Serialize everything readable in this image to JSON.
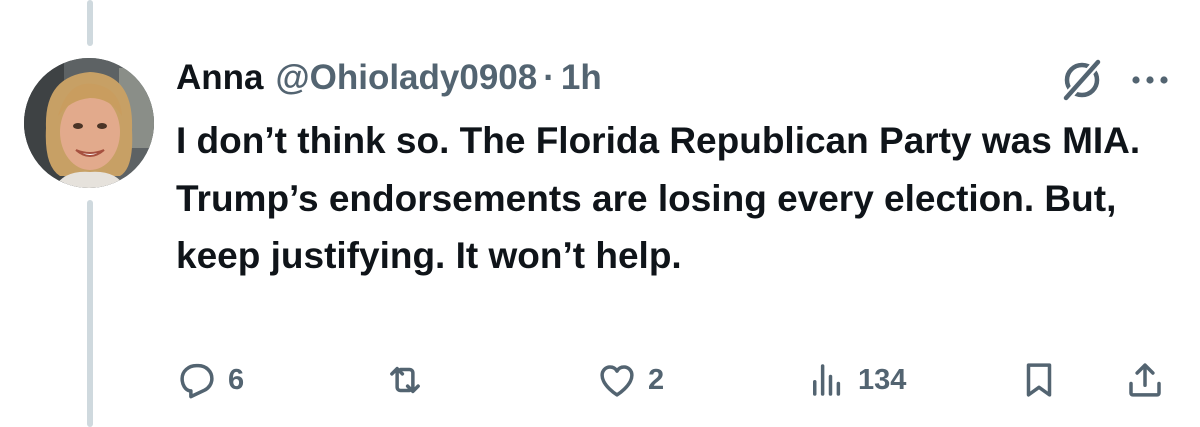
{
  "tweet": {
    "author_name": "Anna",
    "handle": "@Ohiolady0908",
    "separator": "·",
    "time": "1h",
    "text": "I don’t think so. The Florida Republican Party was MIA. Trump’s endorsements are losing every election. But, keep justifying. It won’t help."
  },
  "actions": {
    "replies": "6",
    "reposts": "",
    "likes": "2",
    "views": "134"
  },
  "icons": {
    "reply": "reply-icon",
    "repost": "repost-icon",
    "like": "heart-icon",
    "views": "views-icon",
    "bookmark": "bookmark-icon",
    "share": "share-icon",
    "grok": "grok-icon",
    "more": "more-icon"
  },
  "colors": {
    "text": "#0f1419",
    "secondary": "#536471",
    "thread_line": "#cfd9de",
    "background": "#ffffff"
  }
}
